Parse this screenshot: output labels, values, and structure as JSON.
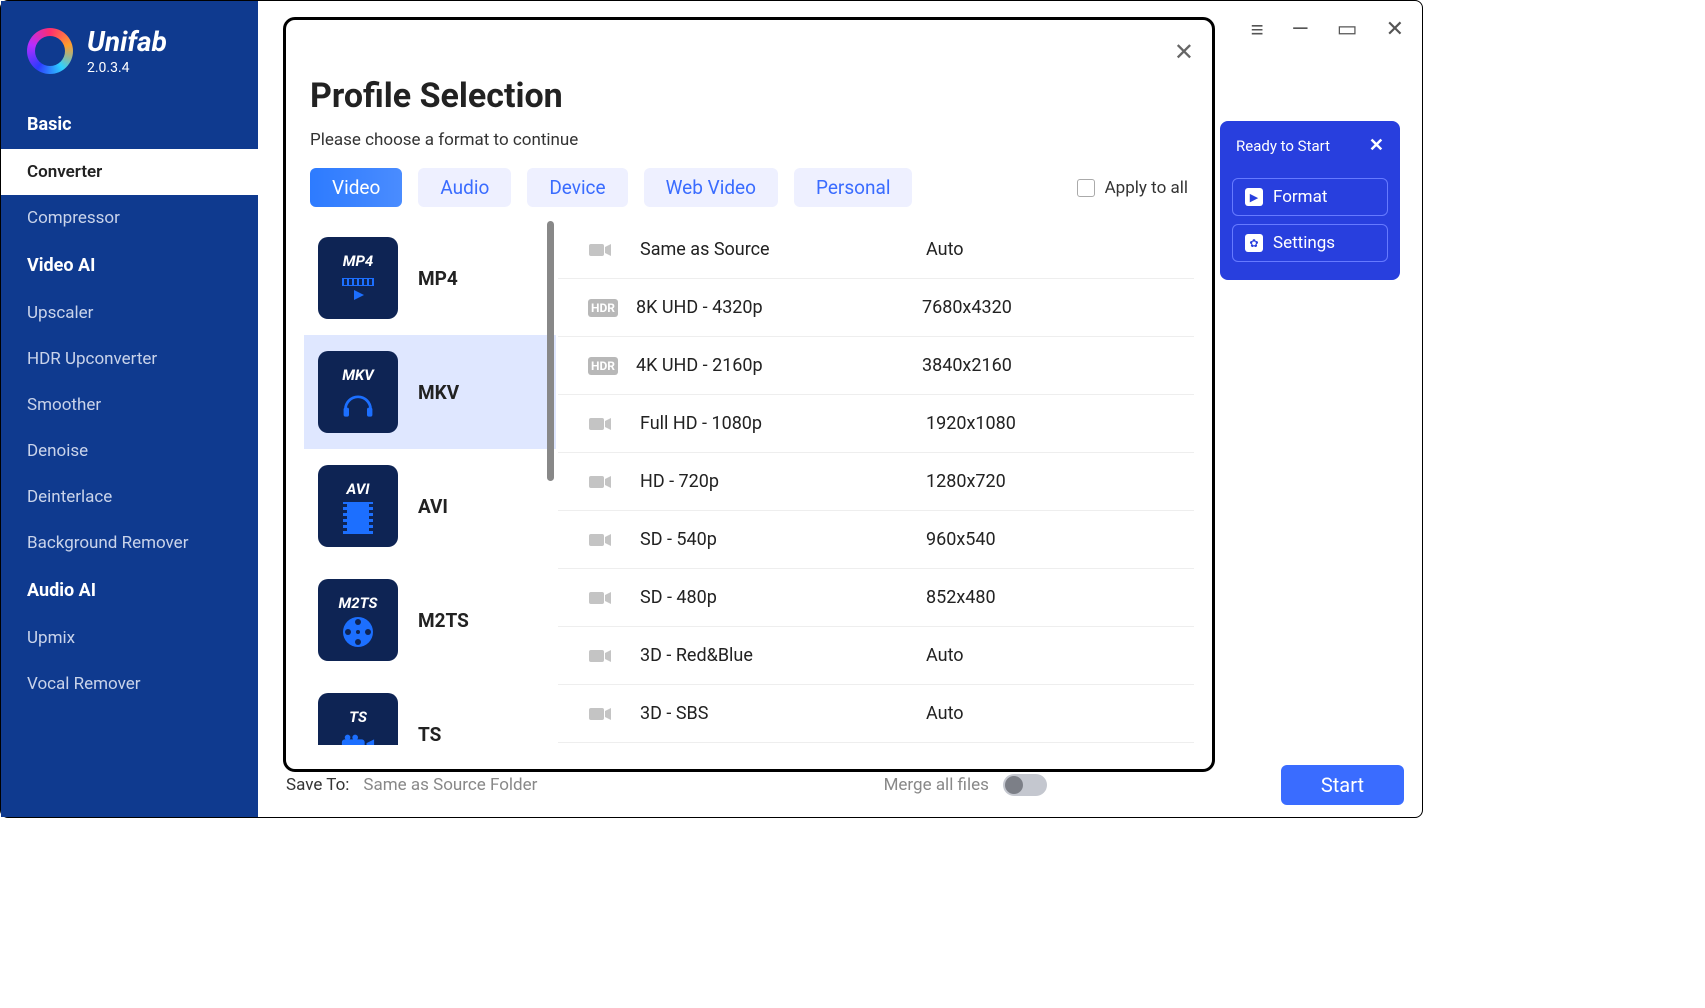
{
  "app": {
    "name": "Unifab",
    "version": "2.0.3.4"
  },
  "sidebar": {
    "groups": [
      {
        "label": "Basic",
        "items": [
          {
            "label": "Converter",
            "active": true
          },
          {
            "label": "Compressor"
          }
        ]
      },
      {
        "label": "Video AI",
        "items": [
          {
            "label": "Upscaler"
          },
          {
            "label": "HDR Upconverter"
          },
          {
            "label": "Smoother"
          },
          {
            "label": "Denoise"
          },
          {
            "label": "Deinterlace"
          },
          {
            "label": "Background Remover"
          }
        ]
      },
      {
        "label": "Audio AI",
        "items": [
          {
            "label": "Upmix"
          },
          {
            "label": "Vocal Remover"
          }
        ]
      }
    ]
  },
  "rightPanel": {
    "status": "Ready to Start",
    "buttons": [
      {
        "label": "Format"
      },
      {
        "label": "Settings"
      }
    ]
  },
  "bottomBar": {
    "saveToLabel": "Save To:",
    "saveToValue": "Same as Source Folder",
    "mergeLabel": "Merge all files",
    "startLabel": "Start"
  },
  "modal": {
    "title": "Profile Selection",
    "subtitle": "Please choose a format to continue",
    "tabs": [
      {
        "label": "Video",
        "active": true
      },
      {
        "label": "Audio"
      },
      {
        "label": "Device"
      },
      {
        "label": "Web Video"
      },
      {
        "label": "Personal"
      }
    ],
    "applyLabel": "Apply to all",
    "formats": [
      {
        "code": "MP4",
        "label": "MP4",
        "glyph": "film-play"
      },
      {
        "code": "MKV",
        "label": "MKV",
        "glyph": "headphones",
        "selected": true
      },
      {
        "code": "AVI",
        "label": "AVI",
        "glyph": "filmstrip"
      },
      {
        "code": "M2TS",
        "label": "M2TS",
        "glyph": "reel"
      },
      {
        "code": "TS",
        "label": "TS",
        "glyph": "camera"
      }
    ],
    "resolutions": [
      {
        "badge": "cam",
        "name": "Same as Source",
        "size": "Auto"
      },
      {
        "badge": "hdr",
        "name": "8K UHD - 4320p",
        "size": "7680x4320"
      },
      {
        "badge": "hdr",
        "name": "4K UHD - 2160p",
        "size": "3840x2160"
      },
      {
        "badge": "cam",
        "name": "Full HD - 1080p",
        "size": "1920x1080"
      },
      {
        "badge": "cam",
        "name": "HD - 720p",
        "size": "1280x720"
      },
      {
        "badge": "cam",
        "name": "SD - 540p",
        "size": "960x540"
      },
      {
        "badge": "cam",
        "name": "SD - 480p",
        "size": "852x480"
      },
      {
        "badge": "cam",
        "name": "3D - Red&Blue",
        "size": "Auto"
      },
      {
        "badge": "cam",
        "name": "3D - SBS",
        "size": "Auto"
      }
    ],
    "hdrBadge": "HDR"
  }
}
